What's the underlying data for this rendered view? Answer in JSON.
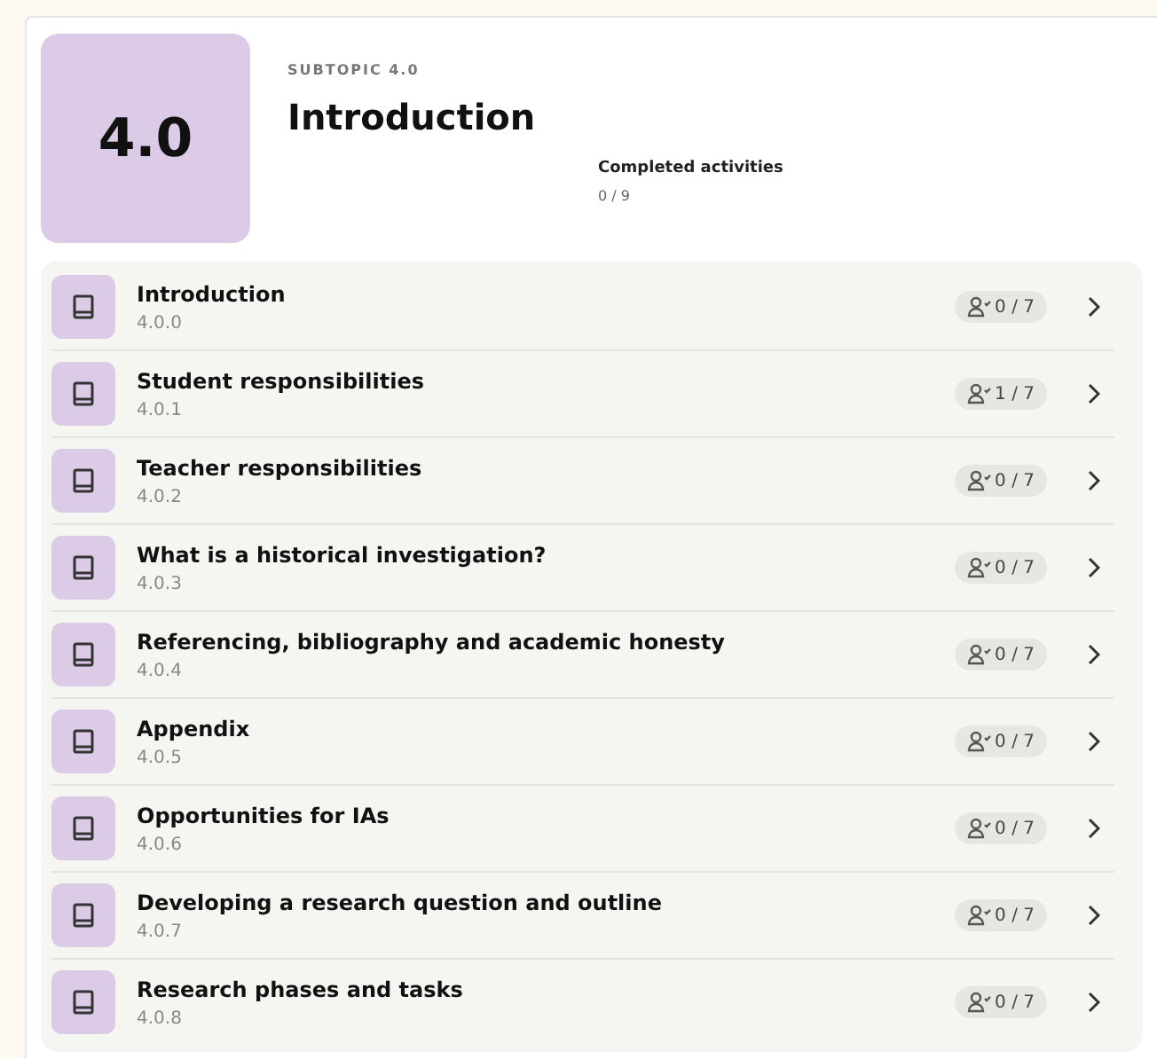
{
  "header": {
    "number": "4.0",
    "overline": "SUBTOPIC 4.0",
    "title": "Introduction",
    "progress": {
      "label": "Completed activities",
      "value": "0 / 9"
    }
  },
  "lessons": [
    {
      "title": "Introduction",
      "code": "4.0.0",
      "count": "0 / 7"
    },
    {
      "title": "Student responsibilities",
      "code": "4.0.1",
      "count": "1 / 7"
    },
    {
      "title": "Teacher responsibilities",
      "code": "4.0.2",
      "count": "0 / 7"
    },
    {
      "title": "What is a historical investigation?",
      "code": "4.0.3",
      "count": "0 / 7"
    },
    {
      "title": "Referencing, bibliography and academic honesty",
      "code": "4.0.4",
      "count": "0 / 7"
    },
    {
      "title": "Appendix",
      "code": "4.0.5",
      "count": "0 / 7"
    },
    {
      "title": "Opportunities for IAs",
      "code": "4.0.6",
      "count": "0 / 7"
    },
    {
      "title": "Developing a research question and outline",
      "code": "4.0.7",
      "count": "0 / 7"
    },
    {
      "title": "Research phases and tasks",
      "code": "4.0.8",
      "count": "0 / 7"
    }
  ]
}
